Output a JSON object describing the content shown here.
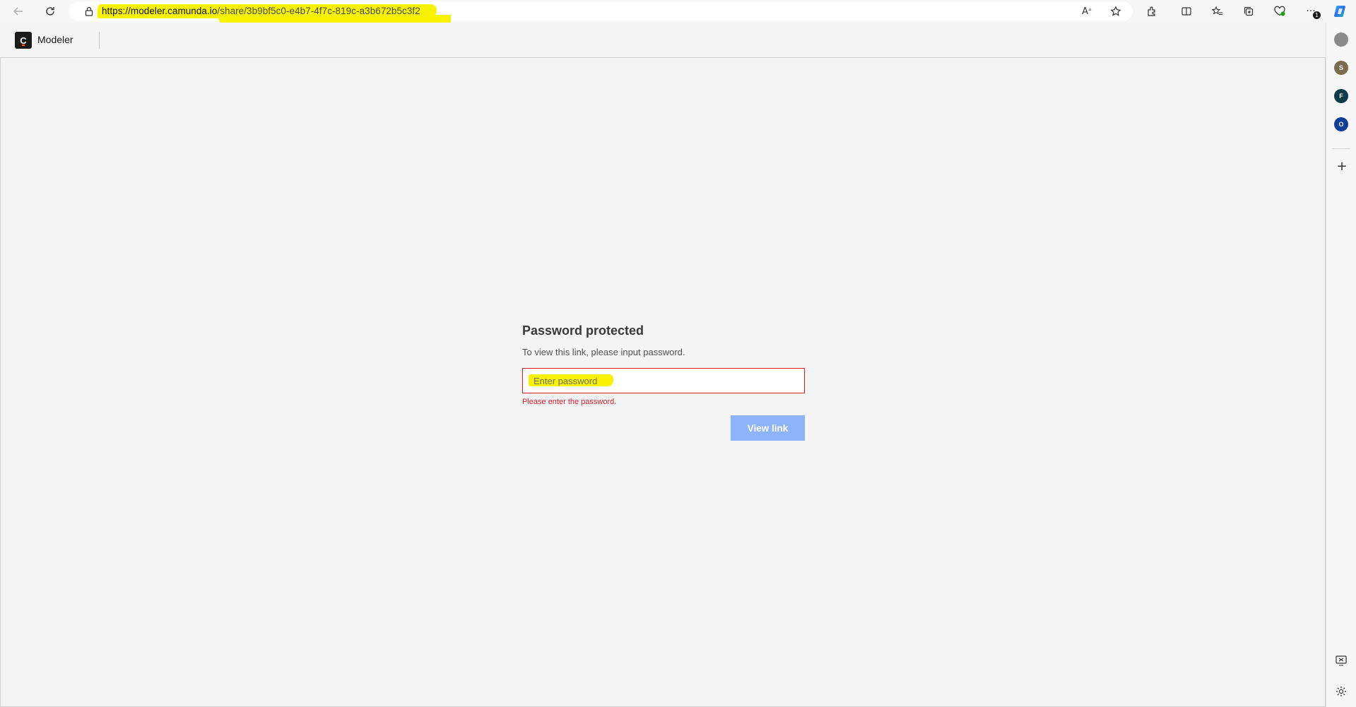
{
  "browser": {
    "url_host": "https://modeler.camunda.io",
    "url_path": "/share/3b9bf5c0-e4b7-4f7c-819c-a3b672b5c3f2",
    "icons": [
      "back-icon",
      "refresh-icon",
      "lock-icon",
      "read-aloud-icon",
      "favorite-star-icon",
      "extensions-icon",
      "split-screen-icon",
      "favorites-icon",
      "collections-icon",
      "browser-essentials-icon",
      "more-icon",
      "copilot-icon"
    ],
    "more_badge": "1"
  },
  "sidebar": {
    "profiles": [
      {
        "letter": "",
        "color": "#8a8a8a"
      },
      {
        "letter": "S",
        "color": "#7a6b4f"
      },
      {
        "letter": "F",
        "color": "#0c3b45"
      },
      {
        "letter": "O",
        "color": "#0f3d9a"
      }
    ],
    "add_label": "+"
  },
  "app": {
    "logo_letter": "C",
    "name": "Modeler"
  },
  "password_form": {
    "title": "Password protected",
    "description": "To view this link, please input password.",
    "placeholder": "Enter password",
    "error": "Please enter the password.",
    "button_label": "View link"
  },
  "colors": {
    "error": "#da1e28",
    "button_disabled": "#8db4fa",
    "highlight": "#f7f200"
  }
}
